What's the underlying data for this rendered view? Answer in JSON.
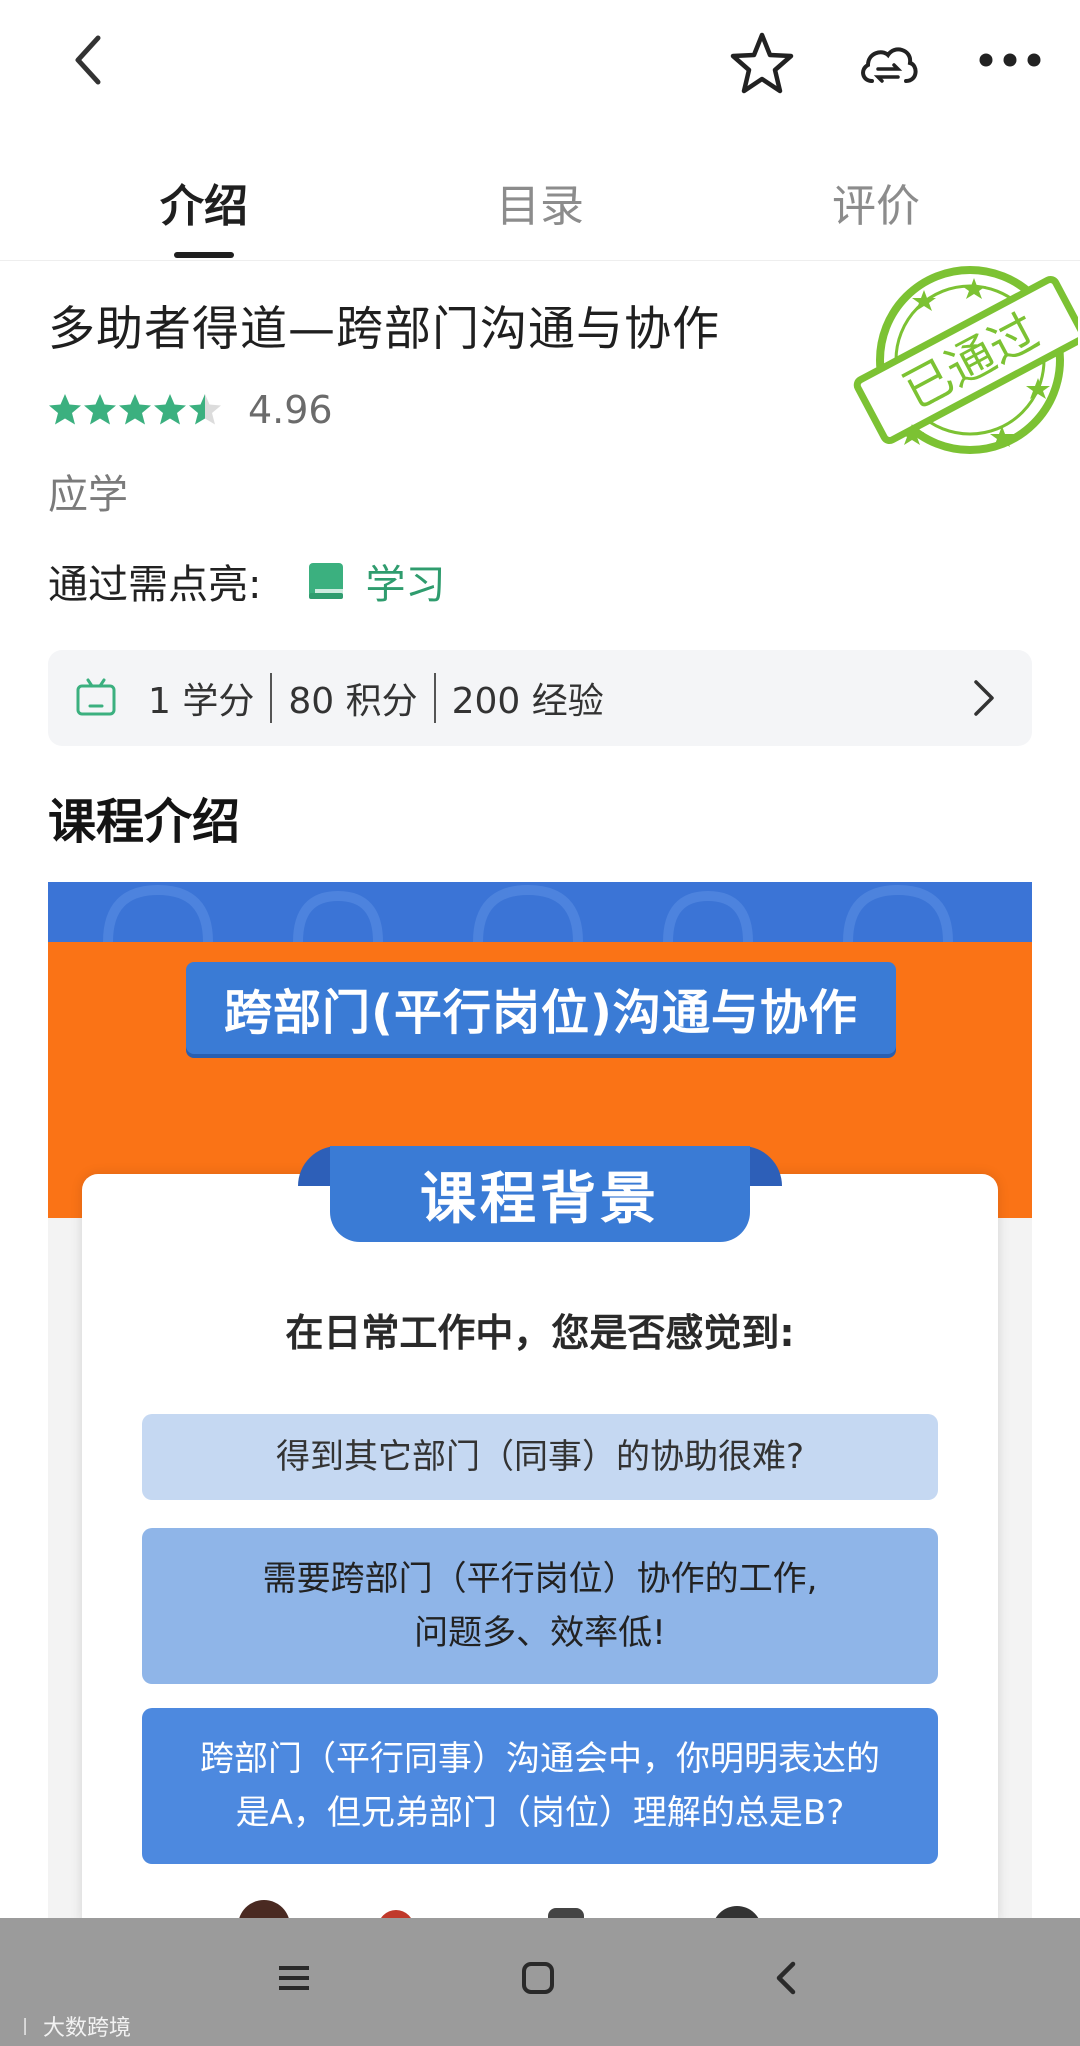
{
  "header": {
    "icons": [
      "back-arrow-icon",
      "star-icon",
      "cloud-sync-icon",
      "more-icon"
    ]
  },
  "tabs": [
    {
      "label": "介绍",
      "active": true
    },
    {
      "label": "目录",
      "active": false
    },
    {
      "label": "评价",
      "active": false
    }
  ],
  "course": {
    "title": "多助者得道—跨部门沟通与协作",
    "rating_stars": 4.5,
    "rating_value": "4.96",
    "category": "应学",
    "requirement_label": "通过需点亮:",
    "requirement_item": "学习",
    "stamp_text": "已通过"
  },
  "credits": {
    "items": [
      "1 学分",
      "80 积分",
      "200 经验"
    ]
  },
  "section": {
    "intro_title": "课程介绍"
  },
  "poster": {
    "banner": "跨部门(平行岗位)沟通与协作",
    "tab": "课程背景",
    "question": "在日常工作中，您是否感觉到:",
    "box1": "得到其它部门（同事）的协助很难?",
    "box2_line1": "需要跨部门（平行岗位）协作的工作,",
    "box2_line2": "问题多、效率低!",
    "box3_line1": "跨部门（平行同事）沟通会中，你明明表达的",
    "box3_line2": "是A，但兄弟部门（岗位）理解的总是B?"
  },
  "navbar": {
    "icons": [
      "menu-icon",
      "home-square-icon",
      "back-chevron-icon"
    ]
  },
  "watermark": "大数跨境",
  "colors": {
    "accent_green": "#2f9c6e",
    "star_green": "#3bb07f",
    "stamp_green": "#7cc233",
    "poster_blue": "#3a7bd5",
    "poster_orange": "#fa7316"
  }
}
